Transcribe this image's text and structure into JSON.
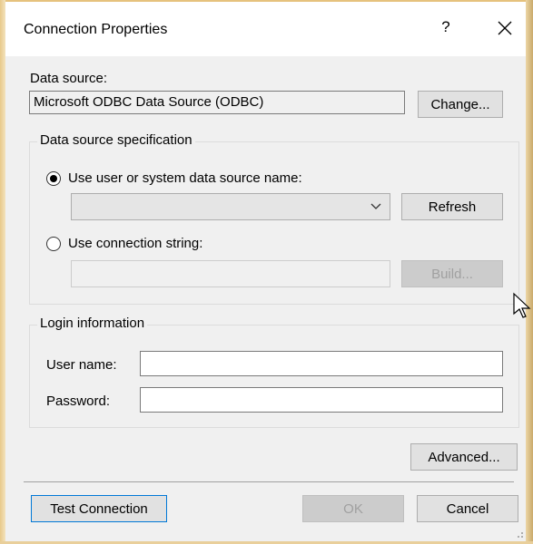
{
  "titlebar": {
    "title": "Connection Properties",
    "help": "?",
    "close": "✕"
  },
  "data_source": {
    "label": "Data source:",
    "value": "Microsoft ODBC Data Source (ODBC)",
    "change_button": "Change..."
  },
  "spec": {
    "group_label": "Data source specification",
    "radio_dsn_label": "Use user or system data source name:",
    "dsn_selected": "",
    "refresh_button": "Refresh",
    "radio_conn_label": "Use connection string:",
    "conn_value": "",
    "build_button": "Build..."
  },
  "login": {
    "group_label": "Login information",
    "user_label": "User name:",
    "user_value": "",
    "password_label": "Password:",
    "password_value": ""
  },
  "footer": {
    "advanced_button": "Advanced...",
    "test_button": "Test Connection",
    "ok_button": "OK",
    "cancel_button": "Cancel"
  },
  "state": {
    "selected_radio": "dsn"
  }
}
